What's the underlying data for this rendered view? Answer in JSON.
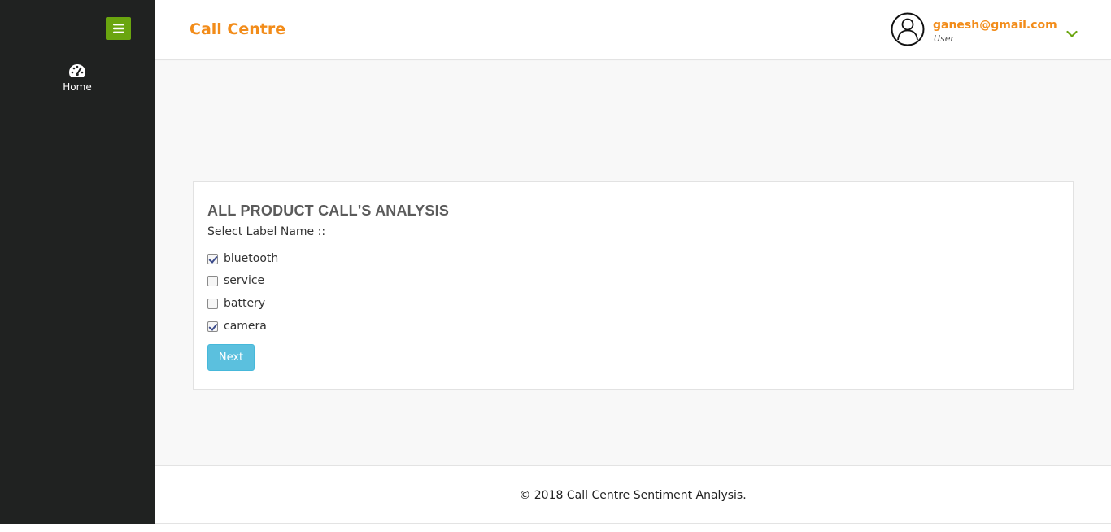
{
  "sidebar": {
    "menu_toggle_icon": "hamburger-menu-icon",
    "items": [
      {
        "label": "Home",
        "icon": "dashboard-icon"
      }
    ]
  },
  "header": {
    "brand": "Call Centre",
    "user": {
      "email": "ganesh@gmail.com",
      "role": "User",
      "avatar_icon": "user-avatar-icon",
      "dropdown_icon": "chevron-down-icon"
    }
  },
  "panel": {
    "title": "ALL PRODUCT CALL'S ANALYSIS",
    "subtitle": "Select Label Name ::",
    "options": [
      {
        "label": "bluetooth",
        "checked": true
      },
      {
        "label": "service",
        "checked": false
      },
      {
        "label": "battery",
        "checked": false
      },
      {
        "label": "camera",
        "checked": true
      }
    ],
    "next_label": "Next"
  },
  "footer": {
    "text": "© 2018 Call Centre Sentiment Analysis."
  },
  "colors": {
    "sidebar_bg": "#202221",
    "accent_orange": "#f28c1a",
    "toggle_green": "#6aa50f",
    "button_blue": "#5bc0de"
  }
}
